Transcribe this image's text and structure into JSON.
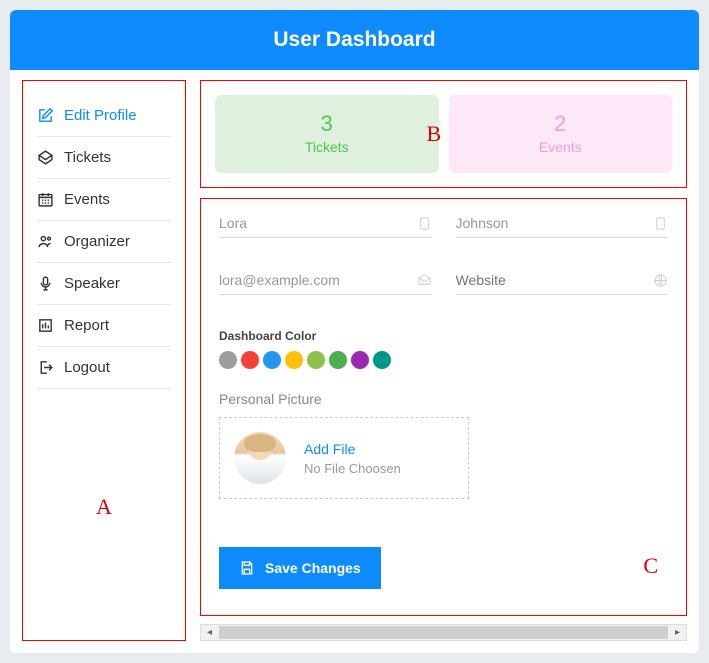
{
  "header": {
    "title": "User Dashboard"
  },
  "sidebar": {
    "items": [
      {
        "label": "Edit Profile",
        "icon": "edit-icon",
        "active": true
      },
      {
        "label": "Tickets",
        "icon": "ticket-icon"
      },
      {
        "label": "Events",
        "icon": "calendar-icon"
      },
      {
        "label": "Organizer",
        "icon": "organizer-icon"
      },
      {
        "label": "Speaker",
        "icon": "mic-icon"
      },
      {
        "label": "Report",
        "icon": "report-icon"
      },
      {
        "label": "Logout",
        "icon": "logout-icon"
      }
    ]
  },
  "stats": {
    "tickets": {
      "count": "3",
      "label": "Tickets"
    },
    "events": {
      "count": "2",
      "label": "Events"
    }
  },
  "form": {
    "first_name": {
      "value": "Lora"
    },
    "last_name": {
      "value": "Johnson"
    },
    "email": {
      "value": "lora@example.com"
    },
    "website": {
      "placeholder": "Website"
    },
    "color_label": "Dashboard Color",
    "colors": [
      "#9e9e9e",
      "#f44336",
      "#2196f3",
      "#ffc107",
      "#8bc34a",
      "#4caf50",
      "#9c27b0",
      "#009688"
    ],
    "picture_label": "Personal Picture",
    "upload": {
      "add": "Add File",
      "none": "No File Choosen"
    },
    "save": "Save Changes"
  },
  "annotations": {
    "a": "A",
    "b": "B",
    "c": "C"
  }
}
